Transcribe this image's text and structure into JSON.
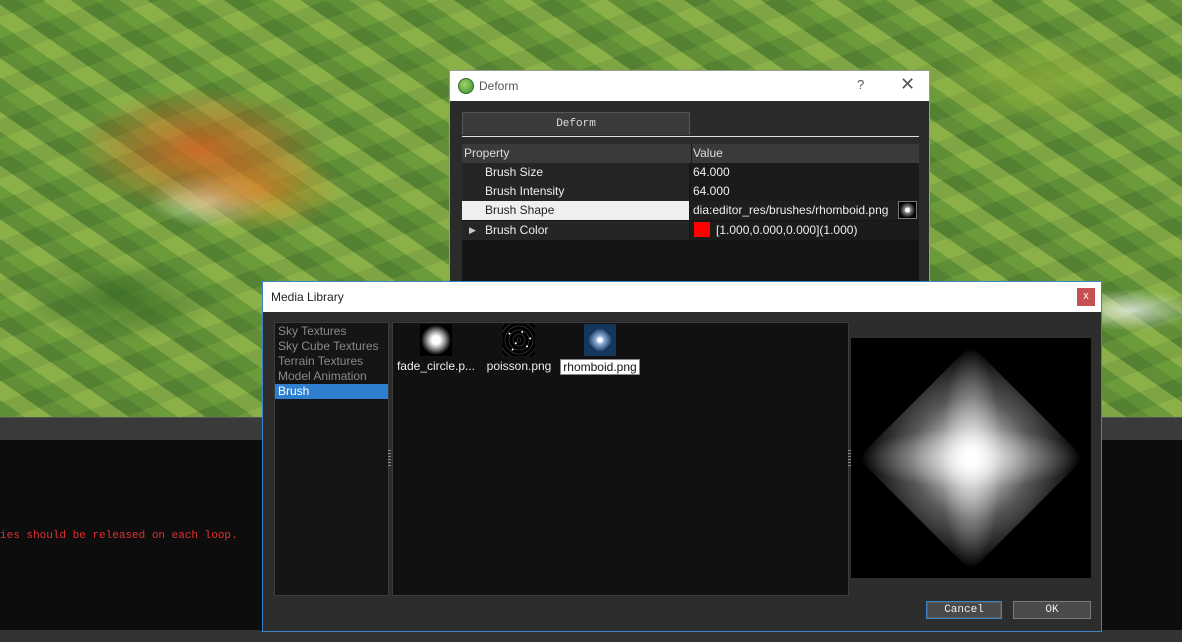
{
  "console": {
    "error_line": "ies should be released on each loop."
  },
  "deform_dialog": {
    "title": "Deform",
    "help_label": "?",
    "close_label": "✕",
    "tab_label": "Deform",
    "columns": {
      "property": "Property",
      "value": "Value"
    },
    "rows": [
      {
        "name": "Brush Size",
        "value": "64.000"
      },
      {
        "name": "Brush Intensity",
        "value": "64.000"
      },
      {
        "name": "Brush Shape",
        "value": "dia:editor_res/brushes/rhomboid.png"
      },
      {
        "name": "Brush Color",
        "value": "[1.000,0.000,0.000](1.000)",
        "color": "#ff0000"
      }
    ]
  },
  "media_library": {
    "title": "Media Library",
    "close_label": "x",
    "categories": [
      "Sky Textures",
      "Sky Cube Textures",
      "Terrain Textures",
      "Model Animation",
      "Brush"
    ],
    "selected_category": "Brush",
    "files": [
      {
        "name": "fade_circle.p...",
        "icon": "fade-circle-thumbnail"
      },
      {
        "name": "poisson.png",
        "icon": "poisson-thumbnail"
      },
      {
        "name": "rhomboid.png",
        "icon": "rhomboid-thumbnail",
        "selected": true
      }
    ],
    "buttons": {
      "cancel": "Cancel",
      "ok": "OK"
    }
  }
}
